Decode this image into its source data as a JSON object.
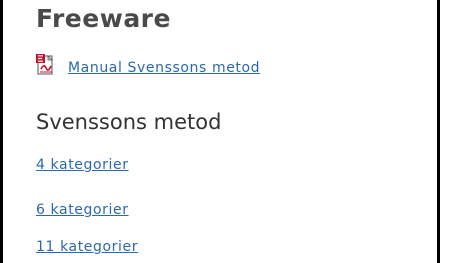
{
  "section": {
    "title": "Freeware"
  },
  "document_link": {
    "icon": "pdf-icon",
    "label": "Manual Svenssons metod"
  },
  "method": {
    "title": "Svenssons metod"
  },
  "category_links": [
    {
      "label": "4 kategorier"
    },
    {
      "label": "6 kategorier"
    },
    {
      "label": "11 kategorier"
    }
  ],
  "colors": {
    "link": "#2c68b0",
    "heading": "#4a4a4a",
    "frame": "#000000"
  }
}
